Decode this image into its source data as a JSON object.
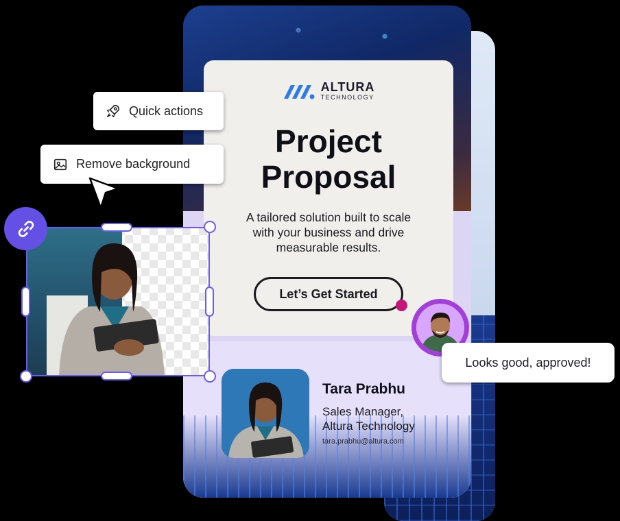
{
  "brand": {
    "name": "ALTURA",
    "subtitle": "TECHNOLOGY",
    "accent": "#2f7ae5"
  },
  "proposal": {
    "title_line1": "Project",
    "title_line2": "Proposal",
    "subtitle_line1": "A tailored solution built to scale",
    "subtitle_line2": "with your business and drive",
    "subtitle_line3": "measurable results.",
    "cta_label": "Let’s Get Started"
  },
  "profile": {
    "name": "Tara Prabhu",
    "role_line1": "Sales Manager,",
    "role_line2": "Altura Technology",
    "email": "tara.prabhu@altura.com"
  },
  "toolbar": {
    "quick_actions_label": "Quick actions",
    "quick_actions_icon": "rocket-icon",
    "remove_background_label": "Remove background",
    "remove_background_icon": "image-icon",
    "link_icon": "link-icon"
  },
  "comment": {
    "text": "Looks good, approved!"
  },
  "colors": {
    "selection": "#6a5cf0",
    "link_button": "#6550e6",
    "avatar_ring": "#a23fd6",
    "cta_dot": "#c4177a",
    "lavender": "#dcd5f4"
  }
}
